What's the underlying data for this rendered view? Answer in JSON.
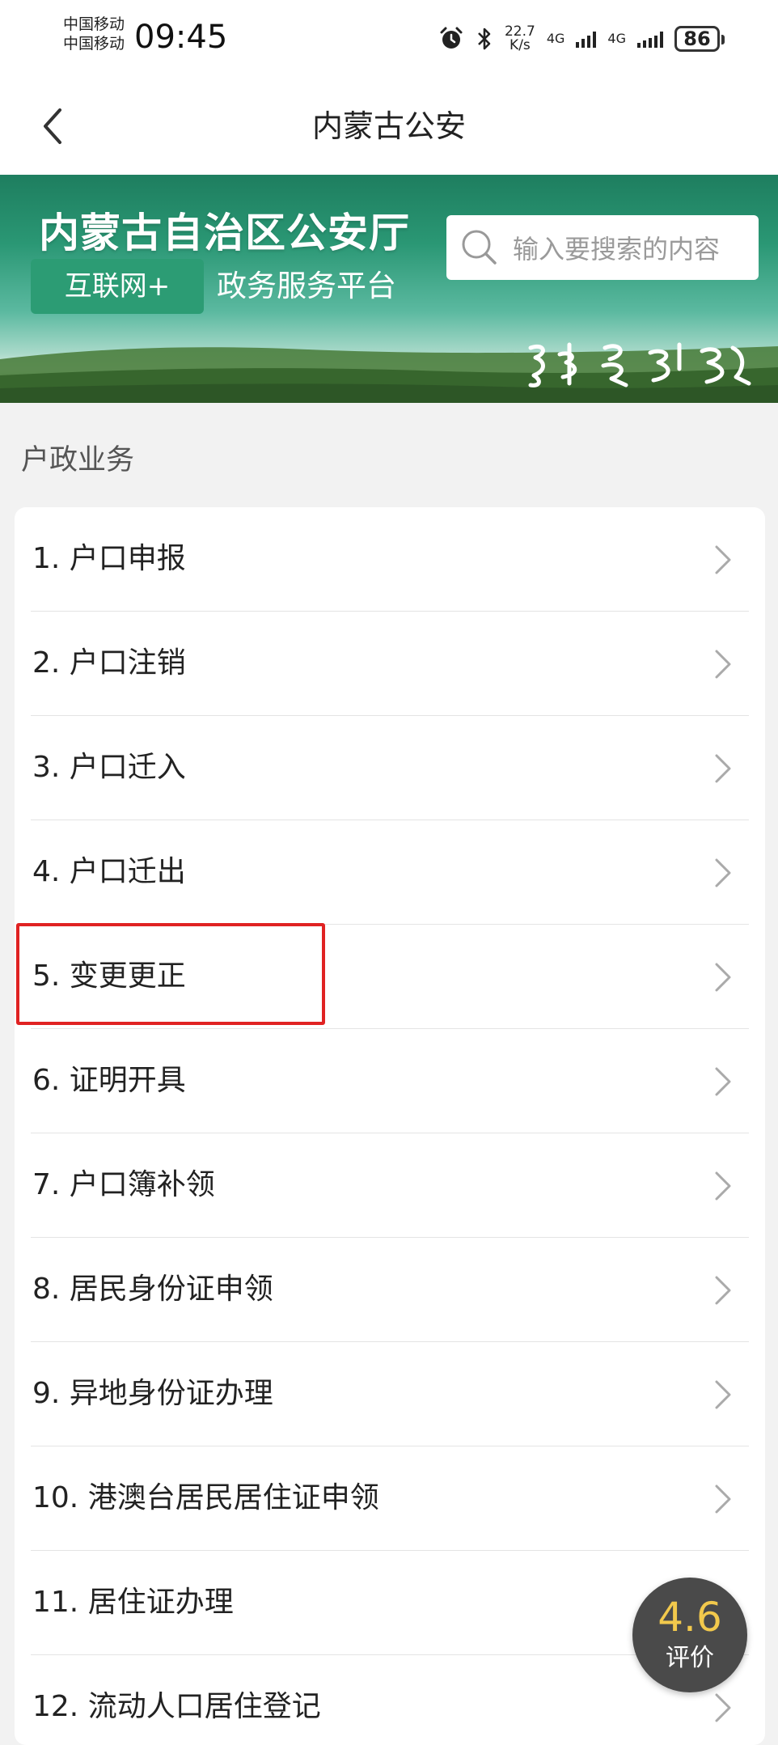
{
  "status_bar": {
    "carrier_1": "中国移动",
    "carrier_2": "中国移动",
    "time": "09:45",
    "speed_value": "22.7",
    "speed_unit": "K/s",
    "net_1": "4G",
    "net_2": "4G",
    "battery": "86"
  },
  "nav": {
    "title": "内蒙古公安"
  },
  "banner": {
    "title": "内蒙古自治区公安厅",
    "tag": "互联网+",
    "subtitle": "政务服务平台",
    "search_placeholder": "输入要搜索的内容",
    "mongolian_logo": "蒙速办"
  },
  "section": {
    "title": "户政业务"
  },
  "list": {
    "items": [
      {
        "label": "1. 户口申报"
      },
      {
        "label": "2. 户口注销"
      },
      {
        "label": "3. 户口迁入"
      },
      {
        "label": "4. 户口迁出"
      },
      {
        "label": "5. 变更更正"
      },
      {
        "label": "6. 证明开具"
      },
      {
        "label": "7. 户口簿补领"
      },
      {
        "label": "8. 居民身份证申领"
      },
      {
        "label": "9. 异地身份证办理"
      },
      {
        "label": "10. 港澳台居民居住证申领"
      },
      {
        "label": "11. 居住证办理"
      },
      {
        "label": "12. 流动人口居住登记"
      }
    ]
  },
  "rating": {
    "score": "4.6",
    "label": "评价"
  },
  "colors": {
    "banner_green": "#2a9774",
    "tag_green": "#2c9c74",
    "highlight_red": "#e02222",
    "rating_yellow": "#f2c94c"
  }
}
